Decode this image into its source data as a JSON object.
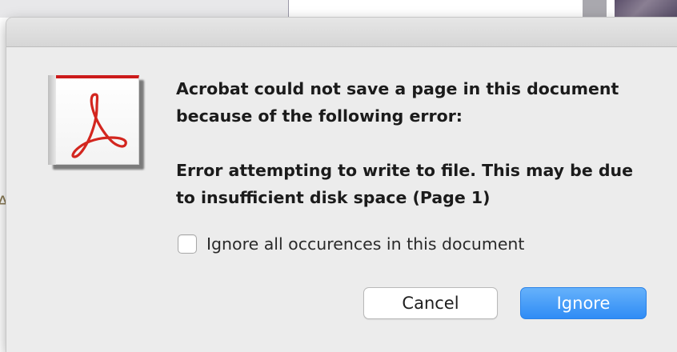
{
  "dialog": {
    "message": "Acrobat could not save a page in this document because of the following error:",
    "error_detail": "Error attempting to write to file. This may be due to insufficient disk space (Page 1)",
    "checkbox": {
      "label": "Ignore all occurences in this document",
      "checked": false
    },
    "buttons": {
      "cancel": "Cancel",
      "ignore": "Ignore"
    },
    "icon": "acrobat-app-icon"
  },
  "background": {
    "side_fragment": "A"
  },
  "colors": {
    "accent_blue": "#2f8cf5",
    "acrobat_red": "#cc1a1a",
    "dialog_bg": "#ececec"
  }
}
